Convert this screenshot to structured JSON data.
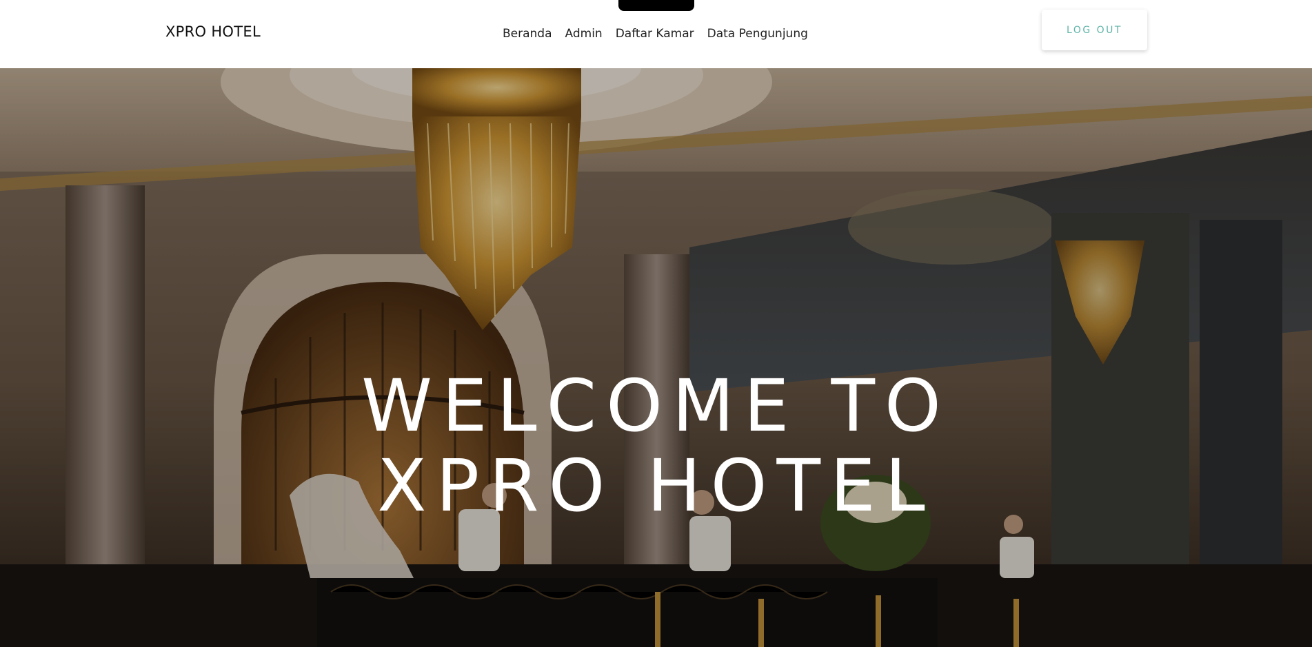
{
  "navbar": {
    "brand": "XPRO HOTEL",
    "links": [
      "Beranda",
      "Admin",
      "Daftar Kamar",
      "Data Pengunjung"
    ],
    "logout_label": "LOG OUT"
  },
  "hero": {
    "title_line1": "WELCOME TO",
    "title_line2": "XPRO HOTEL"
  },
  "colors": {
    "logout_text": "#5fb4a7",
    "nav_text": "#222222",
    "hero_text": "#ffffff"
  }
}
